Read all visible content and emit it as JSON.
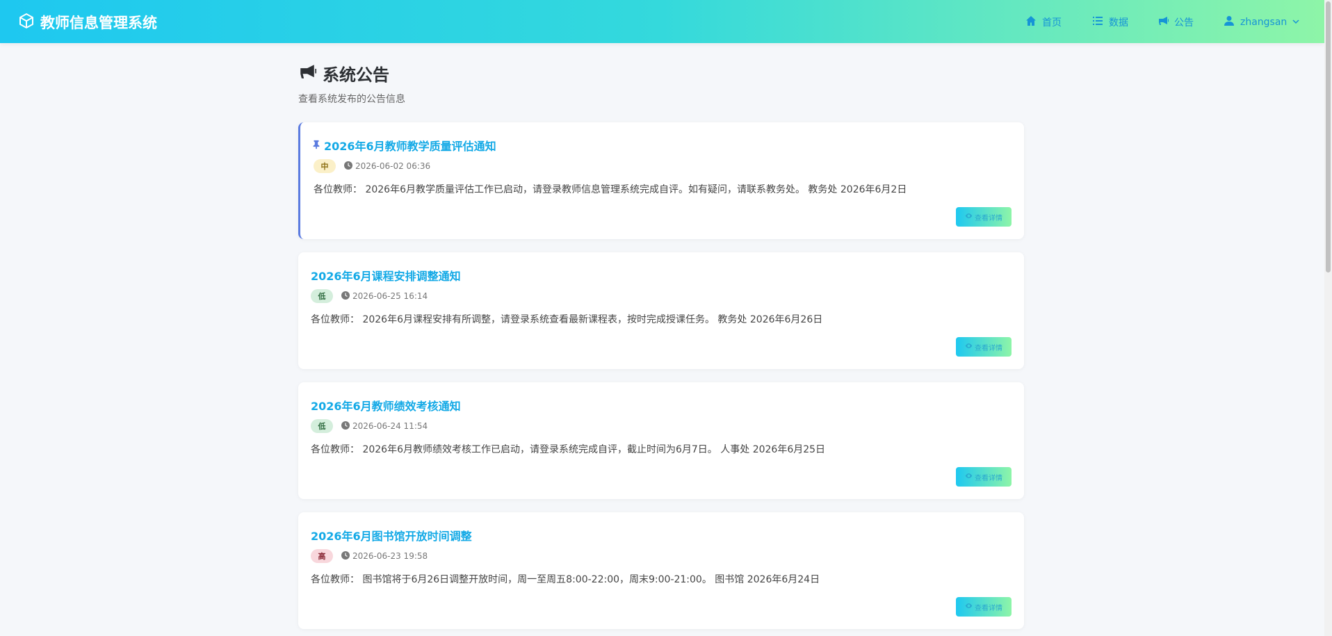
{
  "app": {
    "title": "教师信息管理系统"
  },
  "nav": [
    {
      "label": "首页",
      "icon": "home-icon"
    },
    {
      "label": "数据",
      "icon": "list-icon"
    },
    {
      "label": "公告",
      "icon": "megaphone-icon"
    },
    {
      "label": "zhangsan",
      "icon": "user-icon"
    }
  ],
  "page": {
    "title": "系统公告",
    "subtitle": "查看系统发布的公告信息"
  },
  "detail_label": "查看详情",
  "announcements": [
    {
      "title": "2026年6月教师教学质量评估通知",
      "pinned": true,
      "priority": "中",
      "time": "2026-06-02 06:36",
      "content": "各位教师： 2026年6月教学质量评估工作已启动，请登录教师信息管理系统完成自评。如有疑问，请联系教务处。 教务处 2026年6月2日"
    },
    {
      "title": "2026年6月课程安排调整通知",
      "pinned": false,
      "priority": "低",
      "time": "2026-06-25 16:14",
      "content": "各位教师： 2026年6月课程安排有所调整，请登录系统查看最新课程表，按时完成授课任务。 教务处 2026年6月26日"
    },
    {
      "title": "2026年6月教师绩效考核通知",
      "pinned": false,
      "priority": "低",
      "time": "2026-06-24 11:54",
      "content": "各位教师： 2026年6月教师绩效考核工作已启动，请登录系统完成自评，截止时间为6月7日。 人事处 2026年6月25日"
    },
    {
      "title": "2026年6月图书馆开放时间调整",
      "pinned": false,
      "priority": "高",
      "time": "2026-06-23 19:58",
      "content": "各位教师： 图书馆将于6月26日调整开放时间，周一至周五8:00-22:00，周末9:00-21:00。 图书馆 2026年6月24日"
    }
  ],
  "colors": {
    "accent": "#13a9e6",
    "pin": "#5b7be0",
    "header_start": "#1ec8f0",
    "header_end": "#8ef5a8"
  }
}
